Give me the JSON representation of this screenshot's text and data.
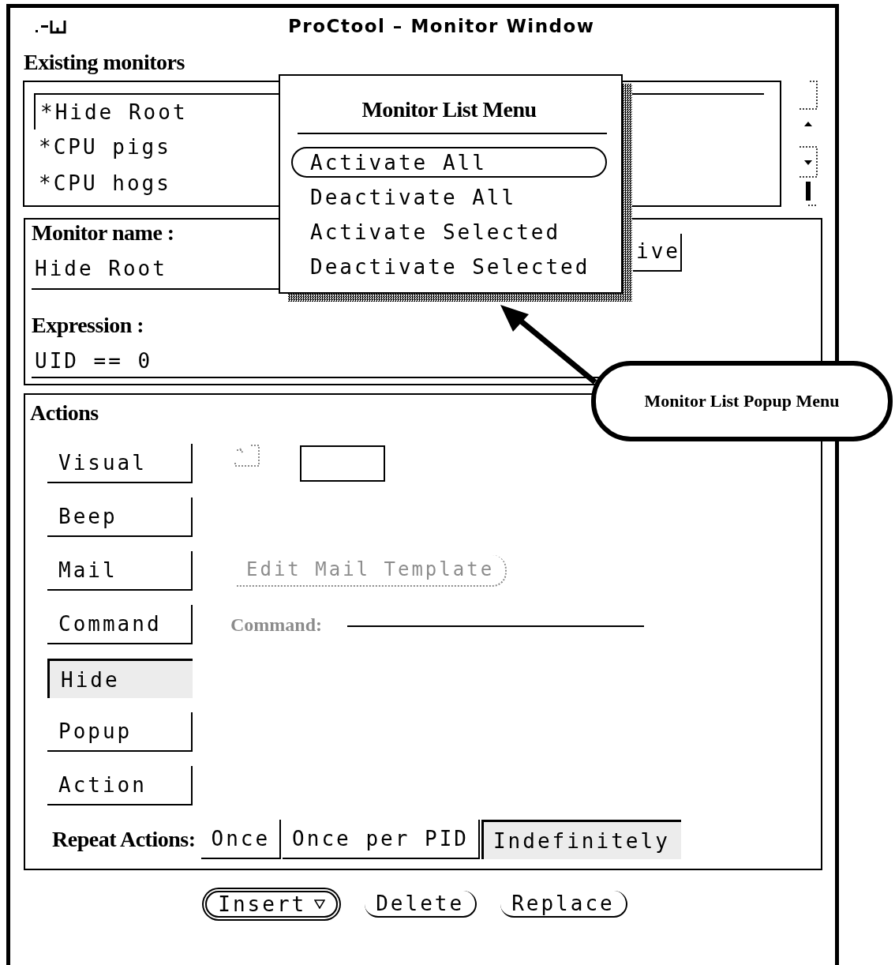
{
  "window": {
    "title": "ProCtool – Monitor Window"
  },
  "existing_monitors": {
    "label": "Existing monitors",
    "items": [
      {
        "text": "*Hide Root",
        "selected": true
      },
      {
        "text": "*CPU pigs",
        "selected": false
      },
      {
        "text": "*CPU hogs",
        "selected": false
      }
    ]
  },
  "monitor_name": {
    "label": "Monitor name :",
    "value": "Hide Root"
  },
  "partial_button": {
    "label": "ive"
  },
  "expression": {
    "label": "Expression :",
    "value": "UID == 0"
  },
  "actions": {
    "label": "Actions",
    "buttons": [
      {
        "label": "Visual",
        "selected": false,
        "kind": "visual"
      },
      {
        "label": "Beep",
        "selected": false,
        "kind": "plain"
      },
      {
        "label": "Mail",
        "selected": false,
        "kind": "mail"
      },
      {
        "label": "Command",
        "selected": false,
        "kind": "command"
      },
      {
        "label": "Hide",
        "selected": true,
        "kind": "plain"
      },
      {
        "label": "Popup",
        "selected": false,
        "kind": "plain"
      },
      {
        "label": "Action",
        "selected": false,
        "kind": "plain"
      }
    ],
    "visual_checkbox": {
      "checked": false,
      "disabled": true
    },
    "mail_template_button": {
      "label": "Edit Mail Template",
      "disabled": true
    },
    "command_field": {
      "label": "Command:",
      "disabled": true
    }
  },
  "repeat_actions": {
    "label": "Repeat Actions:",
    "options": [
      {
        "label": "Once",
        "selected": false
      },
      {
        "label": "Once per PID",
        "selected": false
      },
      {
        "label": "Indefinitely",
        "selected": true
      }
    ]
  },
  "bottom_buttons": [
    {
      "label": "Insert",
      "kind": "menu",
      "default": true
    },
    {
      "label": "Delete",
      "kind": "plain",
      "default": false
    },
    {
      "label": "Replace",
      "kind": "plain",
      "default": false
    }
  ],
  "popup_menu": {
    "title": "Monitor List Menu",
    "items": [
      {
        "label": "Activate All",
        "selected": true
      },
      {
        "label": "Deactivate All",
        "selected": false
      },
      {
        "label": "Activate Selected",
        "selected": false
      },
      {
        "label": "Deactivate Selected",
        "selected": false
      }
    ]
  },
  "callout": {
    "text": "Monitor List Popup Menu"
  }
}
